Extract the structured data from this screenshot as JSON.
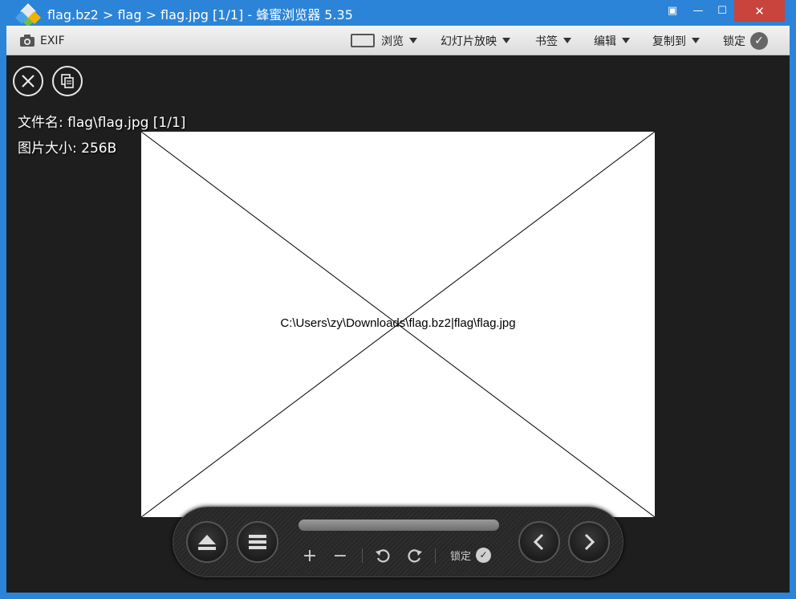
{
  "window": {
    "title": "flag.bz2 > flag > flag.jpg [1/1] - 蜂蜜浏览器 5.35",
    "minimize_icon": "minimize-icon",
    "maximize_icon": "maximize-icon",
    "close_icon": "close-icon",
    "accent_color": "#2b84d8",
    "close_color": "#c8443c"
  },
  "toolbar": {
    "exif_label": "EXIF",
    "browse_label": "浏览",
    "slideshow_label": "幻灯片放映",
    "bookmarks_label": "书签",
    "edit_label": "编辑",
    "copy_to_label": "复制到",
    "lock_label": "锁定"
  },
  "viewer": {
    "filename_text": "文件名: flag\\flag.jpg [1/1]",
    "filesize_text": "图片大小: 256B",
    "image_path": "C:\\Users\\zy\\Downloads\\flag.bz2|flag\\flag.jpg"
  },
  "controls": {
    "lock_label": "锁定"
  }
}
